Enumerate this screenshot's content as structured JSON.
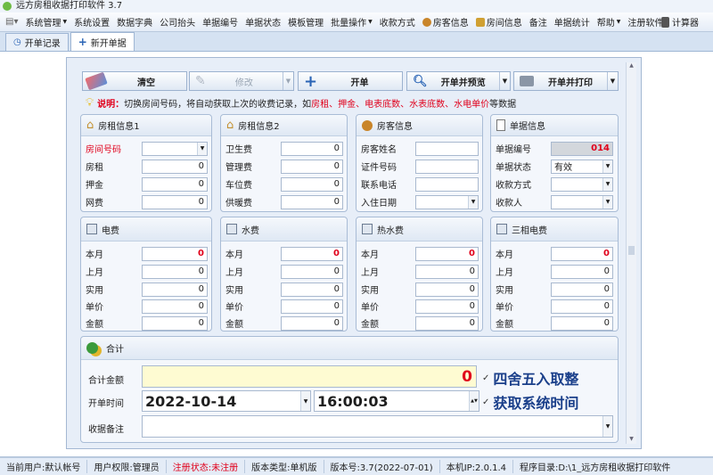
{
  "window": {
    "title": "远方房租收据打印软件 3.7"
  },
  "menu": [
    "系统管理",
    "系统设置",
    "数据字典",
    "公司抬头",
    "单据编号",
    "单据状态",
    "模板管理",
    "批量操作",
    "收款方式",
    "房客信息",
    "房间信息",
    "备注",
    "单据统计",
    "帮助",
    "注册软件",
    "计算器"
  ],
  "tabs": [
    "开单记录",
    "新开单据"
  ],
  "toolbar": {
    "clear": "清空",
    "edit": "修改",
    "open": "开单",
    "open_preview": "开单并预览",
    "open_print": "开单并打印"
  },
  "notice": {
    "prefix": "说明：",
    "text1": "切换房间号码，将自动获取上次的收费记录，如",
    "highlight": "房租、押金、电表底数、水表底数、水电单价",
    "text2": "等数据"
  },
  "rent1": {
    "title": "房租信息1",
    "room_label": "房间号码",
    "rent_label": "房租",
    "rent": "0",
    "deposit_label": "押金",
    "deposit": "0",
    "net_label": "网费",
    "net": "0"
  },
  "rent2": {
    "title": "房租信息2",
    "sanit_label": "卫生费",
    "sanit": "0",
    "mgmt_label": "管理费",
    "mgmt": "0",
    "park_label": "车位费",
    "park": "0",
    "heat_label": "供暖费",
    "heat": "0"
  },
  "tenant": {
    "title": "房客信息",
    "name_label": "房客姓名",
    "id_label": "证件号码",
    "phone_label": "联系电话",
    "date_label": "入住日期"
  },
  "receipt": {
    "title": "单据信息",
    "no_label": "单据编号",
    "no": "014",
    "status_label": "单据状态",
    "status": "有效",
    "method_label": "收款方式",
    "payee_label": "收款人"
  },
  "power": {
    "title": "电费",
    "rows": [
      [
        "本月",
        "0"
      ],
      [
        "上月",
        "0"
      ],
      [
        "实用",
        "0"
      ],
      [
        "单价",
        "0"
      ],
      [
        "金额",
        "0"
      ]
    ]
  },
  "water": {
    "title": "水费",
    "rows": [
      [
        "本月",
        "0"
      ],
      [
        "上月",
        "0"
      ],
      [
        "实用",
        "0"
      ],
      [
        "单价",
        "0"
      ],
      [
        "金额",
        "0"
      ]
    ]
  },
  "hotwater": {
    "title": "热水费",
    "rows": [
      [
        "本月",
        "0"
      ],
      [
        "上月",
        "0"
      ],
      [
        "实用",
        "0"
      ],
      [
        "单价",
        "0"
      ],
      [
        "金额",
        "0"
      ]
    ]
  },
  "threephase": {
    "title": "三相电费",
    "rows": [
      [
        "本月",
        "0"
      ],
      [
        "上月",
        "0"
      ],
      [
        "实用",
        "0"
      ],
      [
        "单价",
        "0"
      ],
      [
        "金额",
        "0"
      ]
    ]
  },
  "summary": {
    "title": "合计",
    "total_label": "合计金额",
    "total": "0",
    "round_label": "四舍五入取整",
    "time_label": "开单时间",
    "date": "2022-10-14",
    "time": "16:00:03",
    "systime_label": "获取系统时间",
    "remark_label": "收据备注"
  },
  "status": [
    "当前用户:默认帐号",
    "用户权限:管理员",
    "注册状态:未注册",
    "版本类型:单机版",
    "版本号:3.7(2022-07-01)",
    "本机IP:2.0.1.4",
    "程序目录:D:\\1_远方房租收据打印软件"
  ],
  "colors": {
    "accent": "#e0001b",
    "total_bg": "#fefbd2",
    "header_blue": "#1a3f8a"
  }
}
